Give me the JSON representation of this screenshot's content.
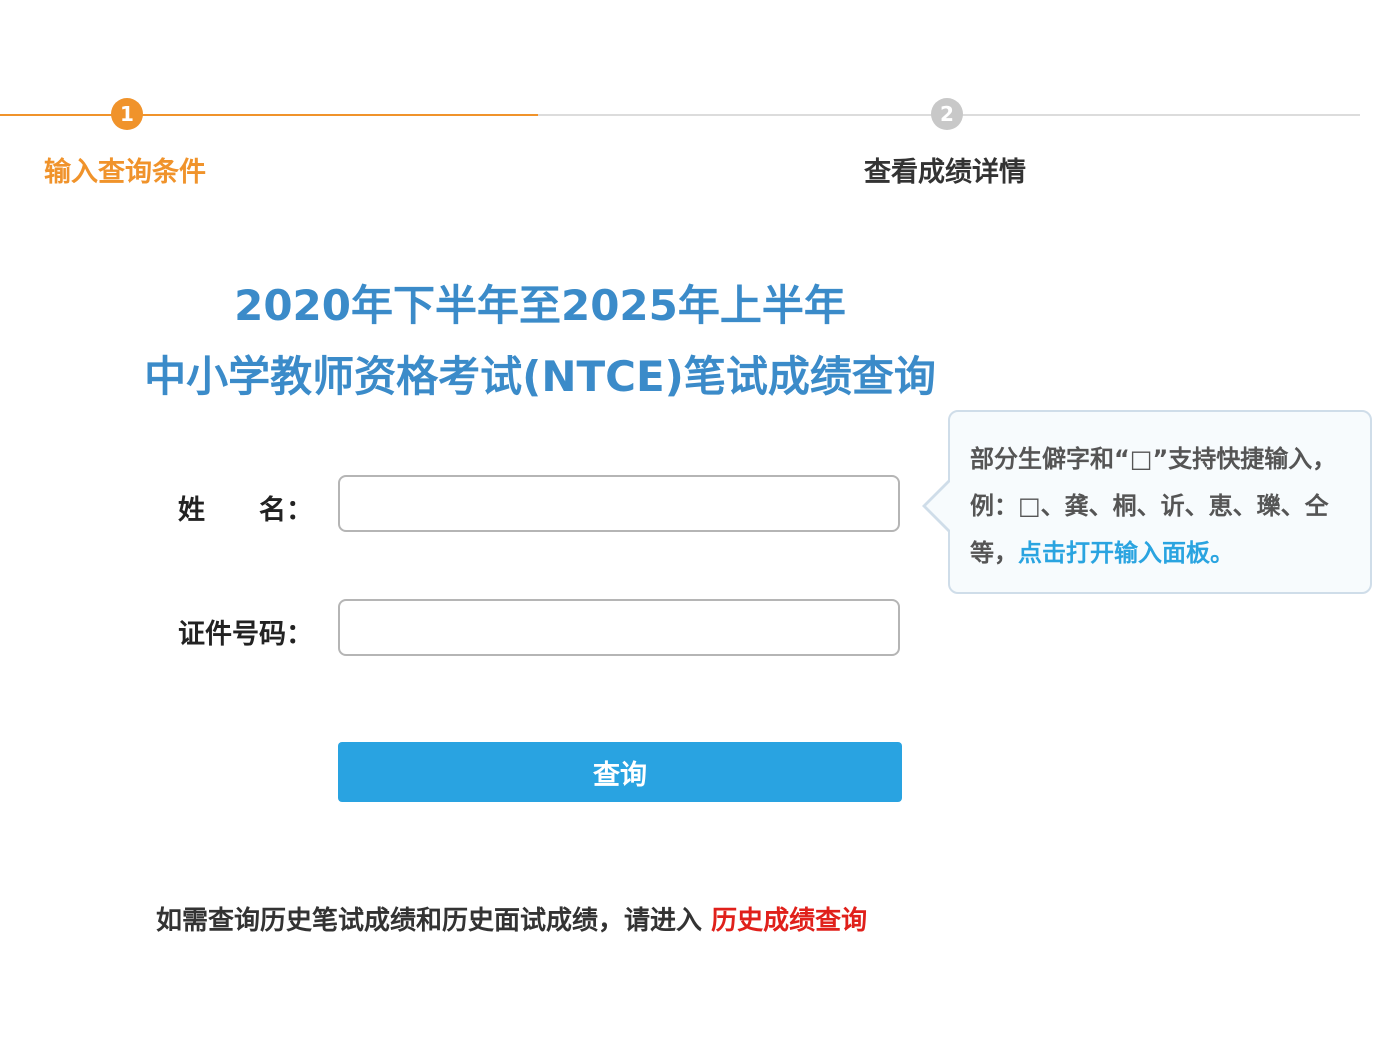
{
  "steps": [
    {
      "number": "1",
      "label": "输入查询条件"
    },
    {
      "number": "2",
      "label": "查看成绩详情"
    }
  ],
  "title": {
    "line1": "2020年下半年至2025年上半年",
    "line2": "中小学教师资格考试(NTCE)笔试成绩查询"
  },
  "form": {
    "name_label": "姓　　名：",
    "id_label": "证件号码：",
    "name_value": "",
    "id_value": "",
    "submit_label": "查询"
  },
  "tooltip": {
    "text": "部分生僻字和“□”支持快捷输入，例：□、龚、桐、䜣、恵、瓅、仝等，",
    "link_label": "点击打开输入面板。"
  },
  "footer": {
    "note": "如需查询历史笔试成绩和历史面试成绩，请进入",
    "link_label": "历史成绩查询"
  },
  "colors": {
    "accent": "#f0932b",
    "title": "#3b8bc9",
    "button": "#29a3e1",
    "link": "#2aa4e0",
    "history_link": "#e0201b"
  }
}
